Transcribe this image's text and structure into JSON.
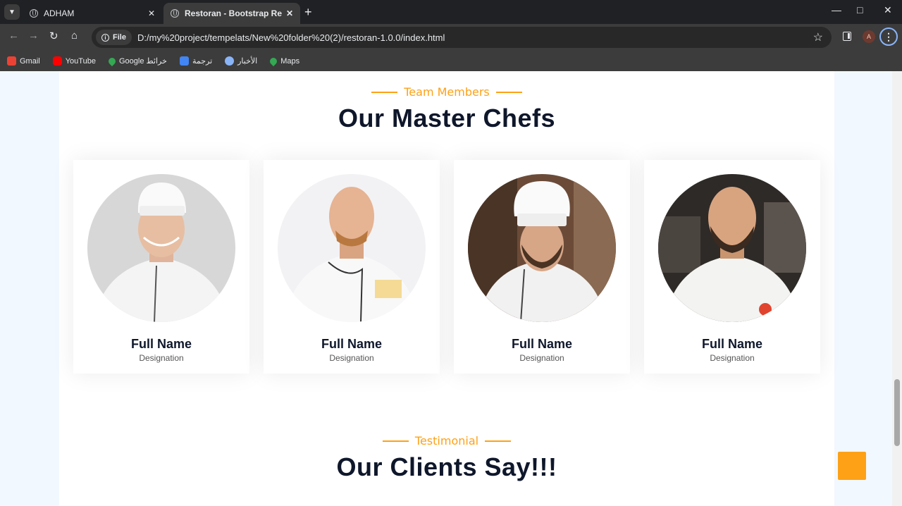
{
  "browser": {
    "tabs": [
      {
        "title": "ADHAM",
        "active": false
      },
      {
        "title": "Restoran - Bootstrap Restaurant Template",
        "active": true
      }
    ],
    "new_tab": "+",
    "address": {
      "chip": "File",
      "url": "D:/my%20project/tempelats/New%20folder%20(2)/restoran-1.0.0/index.html"
    },
    "profile_initial": "A",
    "bookmarks": [
      {
        "label": "Gmail",
        "icon": "gmail-icon"
      },
      {
        "label": "YouTube",
        "icon": "youtube-icon"
      },
      {
        "label": "Google خرائط",
        "icon": "maps-icon"
      },
      {
        "label": "ترجمة",
        "icon": "translate-icon"
      },
      {
        "label": "الأخبار",
        "icon": "news-icon"
      },
      {
        "label": "Maps",
        "icon": "maps-icon"
      }
    ]
  },
  "team": {
    "subtitle": "Team Members",
    "title": "Our Master Chefs",
    "members": [
      {
        "name": "Full Name",
        "designation": "Designation"
      },
      {
        "name": "Full Name",
        "designation": "Designation"
      },
      {
        "name": "Full Name",
        "designation": "Designation"
      },
      {
        "name": "Full Name",
        "designation": "Designation"
      }
    ]
  },
  "testimonial": {
    "subtitle": "Testimonial",
    "title": "Our Clients Say!!!"
  },
  "colors": {
    "accent": "#fea116",
    "heading": "#0f172b",
    "page_bg": "#f1f8ff"
  }
}
